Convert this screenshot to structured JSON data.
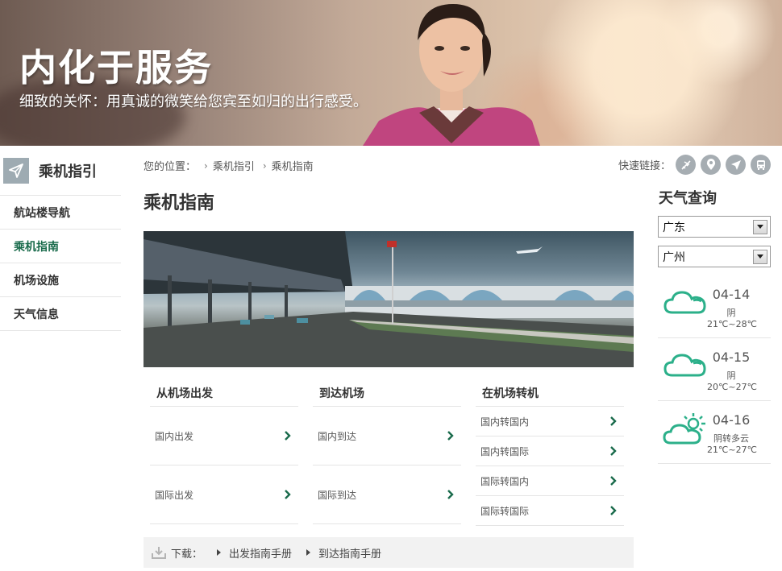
{
  "banner": {
    "title": "内化于服务",
    "subtitle": "细致的关怀：用真诚的微笑给您宾至如归的出行感受。"
  },
  "sidebar": {
    "title": "乘机指引",
    "icon": "paper-plane-icon",
    "items": [
      {
        "label": "航站楼导航",
        "active": false
      },
      {
        "label": "乘机指南",
        "active": true
      },
      {
        "label": "机场设施",
        "active": false
      },
      {
        "label": "天气信息",
        "active": false
      }
    ]
  },
  "breadcrumb": {
    "prefix": "您的位置：",
    "items": [
      "乘机指引",
      "乘机指南"
    ]
  },
  "quick_links": {
    "label": "快速链接：",
    "icons": [
      "plane-icon",
      "location-pin-icon",
      "navigation-arrow-icon",
      "bus-icon"
    ]
  },
  "page": {
    "title": "乘机指南"
  },
  "columns": [
    {
      "heading": "从机场出发",
      "links": [
        "国内出发",
        "国际出发"
      ]
    },
    {
      "heading": "到达机场",
      "links": [
        "国内到达",
        "国际到达"
      ]
    },
    {
      "heading": "在机场转机",
      "links": [
        "国内转国内",
        "国内转国际",
        "国际转国内",
        "国际转国际"
      ]
    }
  ],
  "download": {
    "label": "下载：",
    "files": [
      "出发指南手册",
      "到达指南手册"
    ]
  },
  "weather": {
    "title": "天气查询",
    "province": "广东",
    "city": "广州",
    "days": [
      {
        "date": "04-14",
        "condition": "阴",
        "temp": "21℃~28℃",
        "icon": "cloud-icon"
      },
      {
        "date": "04-15",
        "condition": "阴",
        "temp": "20℃~27℃",
        "icon": "cloud-icon"
      },
      {
        "date": "04-16",
        "condition": "阴转多云",
        "temp": "21℃~27℃",
        "icon": "sun-cloud-icon"
      }
    ]
  },
  "colors": {
    "accent_green": "#1a6b4c",
    "weather_icon": "#2cb08a",
    "sidebar_icon_bg": "#9eabb2"
  }
}
